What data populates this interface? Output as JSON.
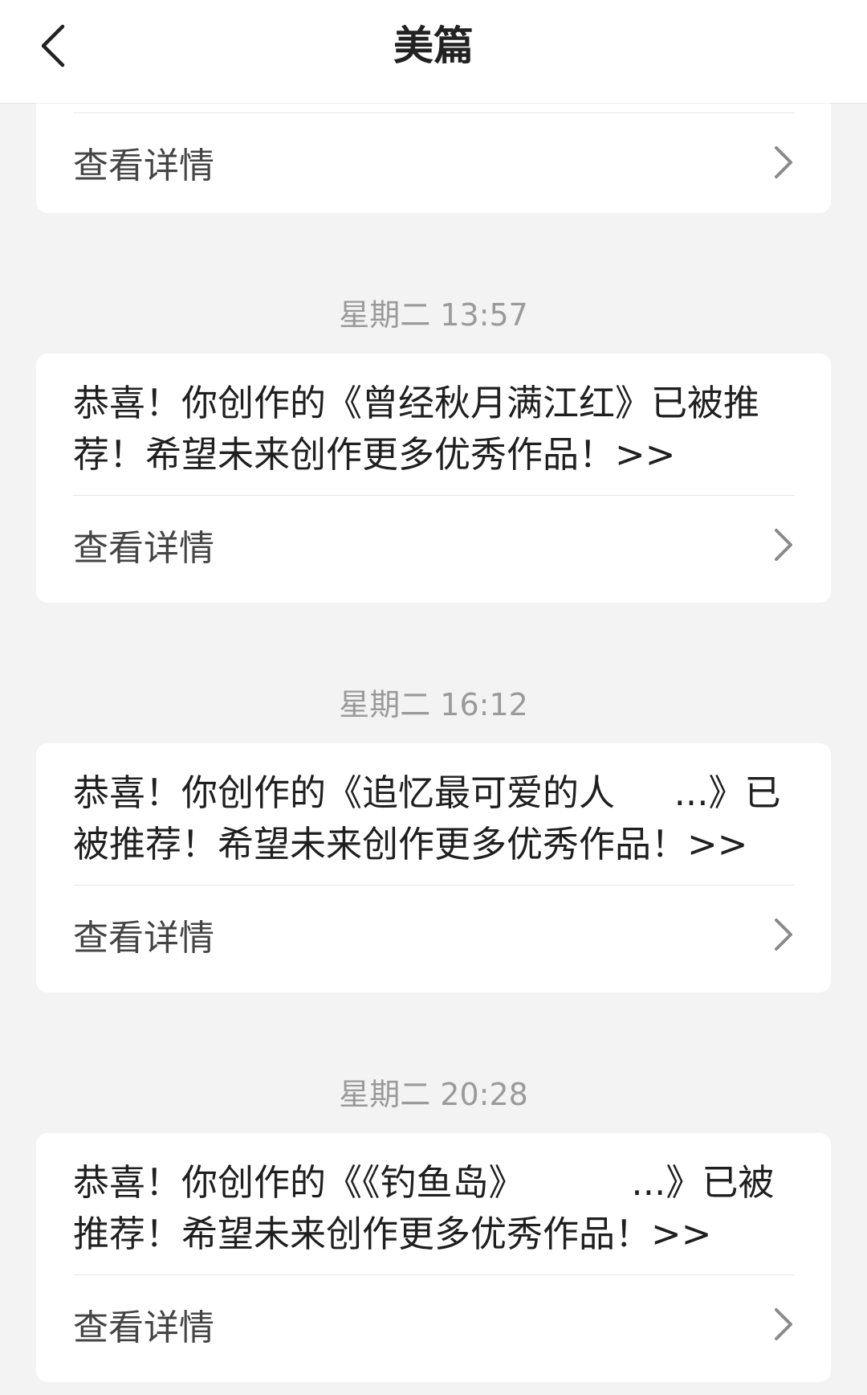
{
  "header": {
    "title": "美篇",
    "back_icon": "chevron-left-icon"
  },
  "messages": [
    {
      "timestamp": "",
      "text": "",
      "detail_label": "查看详情"
    },
    {
      "timestamp": "星期二 13:57",
      "text": "恭喜！你创作的《曾经秋月满江红》已被推荐！希望未来创作更多优秀作品！>>",
      "detail_label": "查看详情"
    },
    {
      "timestamp": "星期二 16:12",
      "text": "恭喜！你创作的《追忆最可爱的人 　 ...》已被推荐！希望未来创作更多优秀作品！>>",
      "detail_label": "查看详情"
    },
    {
      "timestamp": "星期二 20:28",
      "text": "恭喜！你创作的《《钓鱼岛》 　 　 ...》已被推荐！希望未来创作更多优秀作品！>>",
      "detail_label": "查看详情"
    }
  ],
  "colors": {
    "background": "#f3f3f3",
    "card": "#ffffff",
    "timestamp": "#9a9a9a",
    "chevron": "#8a8a8a"
  }
}
